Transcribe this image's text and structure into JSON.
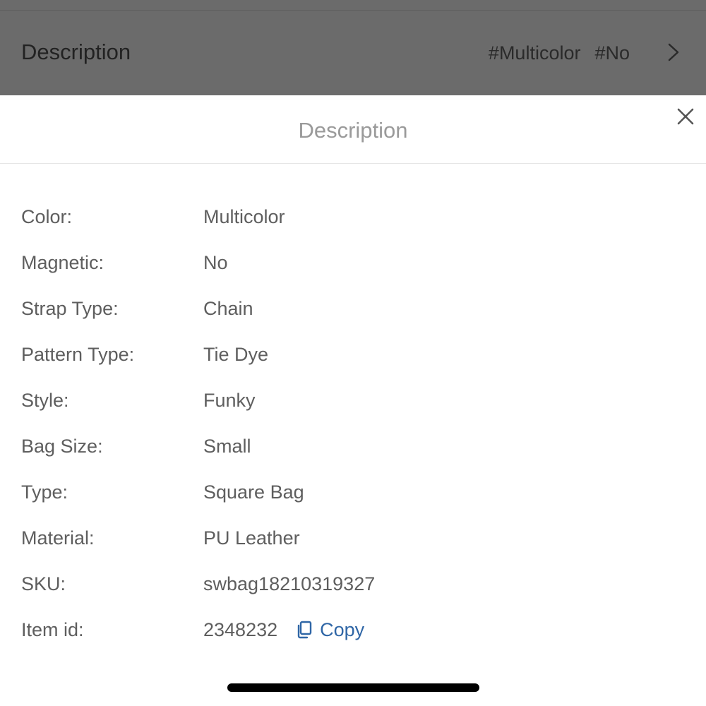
{
  "background": {
    "title": "Description",
    "tags": [
      "#Multicolor",
      "#No"
    ],
    "chevron_icon": "chevron-right-icon"
  },
  "sheet": {
    "title": "Description",
    "close_icon": "close-icon"
  },
  "attributes": [
    {
      "label": "Color:",
      "value": "Multicolor"
    },
    {
      "label": "Magnetic:",
      "value": "No"
    },
    {
      "label": "Strap Type:",
      "value": "Chain"
    },
    {
      "label": "Pattern Type:",
      "value": "Tie Dye"
    },
    {
      "label": "Style:",
      "value": "Funky"
    },
    {
      "label": "Bag Size:",
      "value": "Small"
    },
    {
      "label": "Type:",
      "value": "Square Bag"
    },
    {
      "label": "Material:",
      "value": "PU Leather"
    },
    {
      "label": "SKU:",
      "value": "swbag18210319327"
    },
    {
      "label": "Item id:",
      "value": "2348232"
    }
  ],
  "copy": {
    "label": "Copy",
    "icon": "copy-icon",
    "color": "#2f66a6"
  },
  "colors": {
    "overlay": "#6b6b6b",
    "label_text": "#5e5e5e",
    "sheet_title": "#9a9a9a"
  }
}
